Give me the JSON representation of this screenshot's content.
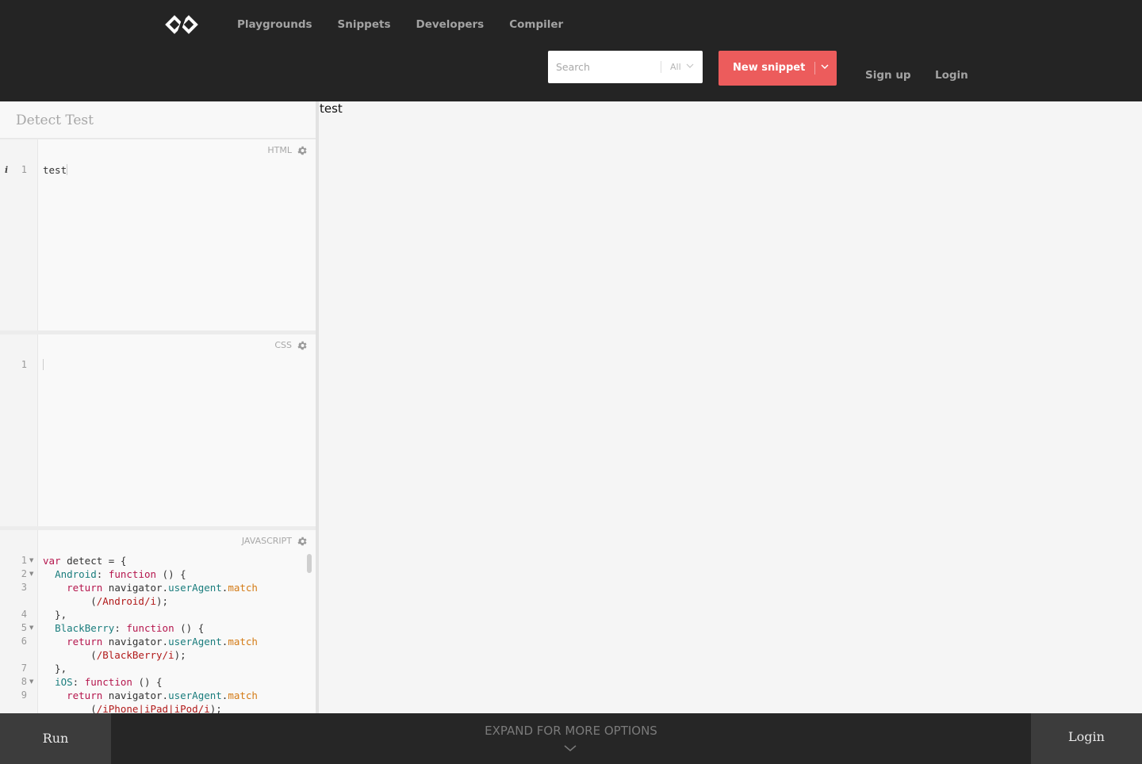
{
  "header": {
    "logo": "codepen-like-logo-icon",
    "nav": [
      "Playgrounds",
      "Snippets",
      "Developers",
      "Compiler"
    ],
    "search_placeholder": "Search",
    "search_filter": "All",
    "new_snippet_label": "New snippet",
    "signup_label": "Sign up",
    "login_label": "Login"
  },
  "editor": {
    "snippet_title": "Detect Test",
    "html_panel": {
      "label": "HTML",
      "line_numbers": [
        "1"
      ],
      "code": "test"
    },
    "css_panel": {
      "label": "CSS",
      "line_numbers": [
        "1"
      ],
      "code": ""
    },
    "js_panel": {
      "label": "JAVASCRIPT",
      "line_numbers": [
        "1",
        "2",
        "3",
        "4",
        "5",
        "6",
        "7",
        "8",
        "9"
      ]
    }
  },
  "preview": {
    "output_text": "test"
  },
  "footer": {
    "run_label": "Run",
    "expand_label": "EXPAND FOR MORE OPTIONS",
    "login_label": "Login"
  },
  "colors": {
    "accent": "#ec5c5c",
    "header_bg": "#242424",
    "keyword": "#b5164d",
    "property": "#1a7d7d",
    "method": "#d47b16",
    "regex": "#b11a1a"
  }
}
